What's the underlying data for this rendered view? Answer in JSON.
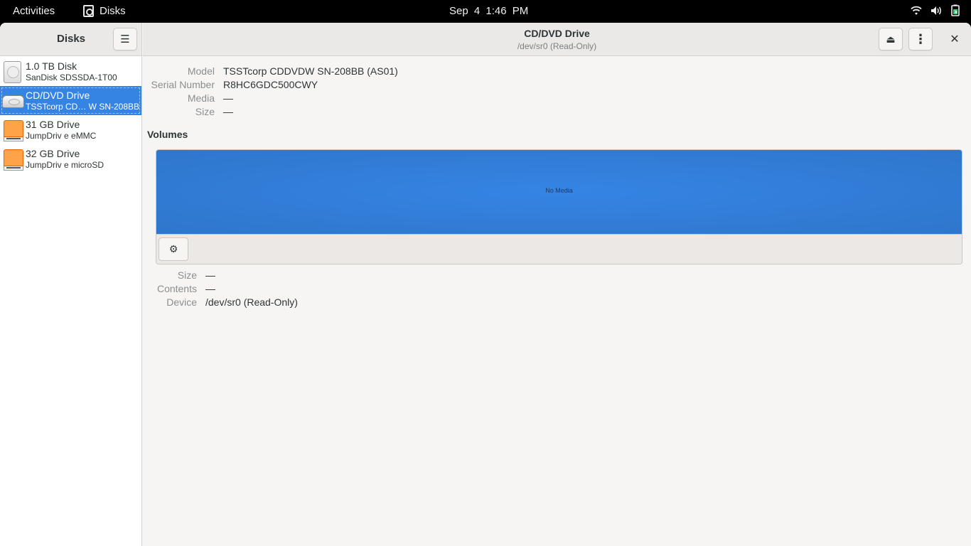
{
  "topbar": {
    "activities": "Activities",
    "app_name": "Disks",
    "app_icon": "disks-app-icon",
    "clock": "Sep 4  1:46 PM",
    "status_icons": [
      "wifi-icon",
      "volume-icon",
      "battery-charging-icon"
    ]
  },
  "sidebar": {
    "title": "Disks",
    "menu_icon": "hamburger-menu-icon",
    "disks": [
      {
        "name": "1.0 TB Disk",
        "subtitle": "SanDisk SDSSDA-1T00",
        "icon": "hard-disk-icon",
        "selected": false
      },
      {
        "name": "CD/DVD Drive",
        "subtitle": "TSSTcorp CD… W SN-208BB",
        "icon": "optical-drive-icon",
        "selected": true
      },
      {
        "name": "31 GB Drive",
        "subtitle": "JumpDriv e eMMC",
        "icon": "usb-drive-icon",
        "selected": false
      },
      {
        "name": "32 GB Drive",
        "subtitle": "JumpDriv e microSD",
        "icon": "usb-drive-icon",
        "selected": false
      }
    ]
  },
  "header": {
    "title": "CD/DVD Drive",
    "subtitle": "/dev/sr0 (Read-Only)",
    "eject_glyph": "⏏",
    "kebab_glyph": "⋮",
    "close_glyph": "✕"
  },
  "drive": {
    "model_label": "Model",
    "model_value": "TSSTcorp CDDVDW SN-208BB (AS01)",
    "serial_label": "Serial Number",
    "serial_value": "R8HC6GDC500CWY",
    "media_label": "Media",
    "media_value": "—",
    "size_label": "Size",
    "size_value": "—"
  },
  "volumes": {
    "label": "Volumes",
    "bar_text": "No Media",
    "bar_color": "#3584e4",
    "gear_glyph": "⚙",
    "size_label": "Size",
    "size_value": "—",
    "contents_label": "Contents",
    "contents_value": "—",
    "device_label": "Device",
    "device_value": "/dev/sr0 (Read-Only)"
  }
}
